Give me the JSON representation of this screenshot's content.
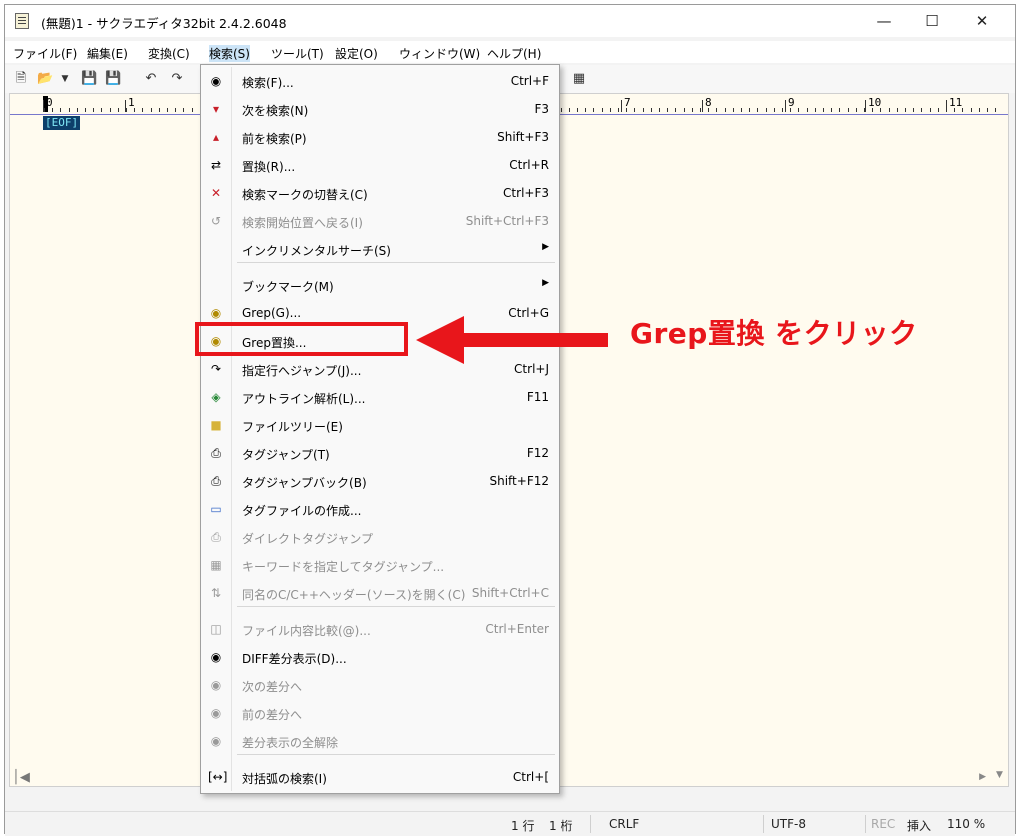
{
  "window": {
    "title": "(無題)1 - サクラエディタ32bit 2.4.2.6048"
  },
  "menubar": [
    "ファイル(F)",
    "編集(E)",
    "変換(C)",
    "検索(S)",
    "ツール(T)",
    "設定(O)",
    "ウィンドウ(W)",
    "ヘルプ(H)"
  ],
  "ruler": [
    "0",
    "1",
    "7",
    "8",
    "9",
    "10",
    "11"
  ],
  "editor": {
    "eof": "[EOF]"
  },
  "menu": {
    "items": [
      {
        "label": "検索(F)...",
        "shortcut": "Ctrl+F",
        "icon": "binoculars-icon",
        "disabled": false
      },
      {
        "label": "次を検索(N)",
        "shortcut": "F3",
        "icon": "find-next-icon",
        "disabled": false
      },
      {
        "label": "前を検索(P)",
        "shortcut": "Shift+F3",
        "icon": "find-prev-icon",
        "disabled": false
      },
      {
        "label": "置換(R)...",
        "shortcut": "Ctrl+R",
        "icon": "replace-icon",
        "disabled": false
      },
      {
        "label": "検索マークの切替え(C)",
        "shortcut": "Ctrl+F3",
        "icon": "mark-toggle-icon",
        "disabled": false
      },
      {
        "label": "検索開始位置へ戻る(I)",
        "shortcut": "Shift+Ctrl+F3",
        "icon": "return-icon",
        "disabled": true
      },
      {
        "label": "インクリメンタルサーチ(S)",
        "shortcut": "",
        "icon": "",
        "disabled": false,
        "submenu": true
      },
      {
        "label": "ブックマーク(M)",
        "shortcut": "",
        "icon": "",
        "disabled": false,
        "submenu": true
      },
      {
        "label": "Grep(G)...",
        "shortcut": "Ctrl+G",
        "icon": "grep-icon",
        "disabled": false
      },
      {
        "label": "Grep置換...",
        "shortcut": "",
        "icon": "grep-replace-icon",
        "disabled": false
      },
      {
        "label": "指定行へジャンプ(J)...",
        "shortcut": "Ctrl+J",
        "icon": "jump-icon",
        "disabled": false
      },
      {
        "label": "アウトライン解析(L)...",
        "shortcut": "F11",
        "icon": "outline-icon",
        "disabled": false
      },
      {
        "label": "ファイルツリー(E)",
        "shortcut": "",
        "icon": "folder-icon",
        "disabled": false
      },
      {
        "label": "タグジャンプ(T)",
        "shortcut": "F12",
        "icon": "tag-jump-icon",
        "disabled": false
      },
      {
        "label": "タグジャンプバック(B)",
        "shortcut": "Shift+F12",
        "icon": "tag-jump-back-icon",
        "disabled": false
      },
      {
        "label": "タグファイルの作成...",
        "shortcut": "",
        "icon": "tag-file-icon",
        "disabled": false
      },
      {
        "label": "ダイレクトタグジャンプ",
        "shortcut": "",
        "icon": "direct-tag-icon",
        "disabled": true
      },
      {
        "label": "キーワードを指定してタグジャンプ...",
        "shortcut": "",
        "icon": "keyword-tag-icon",
        "disabled": true
      },
      {
        "label": "同名のC/C++ヘッダー(ソース)を開く(C)",
        "shortcut": "Shift+Ctrl+C",
        "icon": "header-icon",
        "disabled": true
      },
      {
        "label": "ファイル内容比較(@)...",
        "shortcut": "Ctrl+Enter",
        "icon": "compare-icon",
        "disabled": true
      },
      {
        "label": "DIFF差分表示(D)...",
        "shortcut": "",
        "icon": "diff-icon",
        "disabled": false
      },
      {
        "label": "次の差分へ",
        "shortcut": "",
        "icon": "next-diff-icon",
        "disabled": true
      },
      {
        "label": "前の差分へ",
        "shortcut": "",
        "icon": "prev-diff-icon",
        "disabled": true
      },
      {
        "label": "差分表示の全解除",
        "shortcut": "",
        "icon": "clear-diff-icon",
        "disabled": true
      },
      {
        "label": "対括弧の検索(I)",
        "shortcut": "Ctrl+[",
        "icon": "bracket-icon",
        "disabled": false
      }
    ]
  },
  "annotation": {
    "text": "Grep置換 をクリック",
    "color": "#e8161b"
  },
  "status": {
    "line": "1 行",
    "col": "1 桁",
    "eol": "CRLF",
    "encoding": "UTF-8",
    "rec": "REC",
    "mode": "挿入",
    "zoom": "110 %"
  }
}
